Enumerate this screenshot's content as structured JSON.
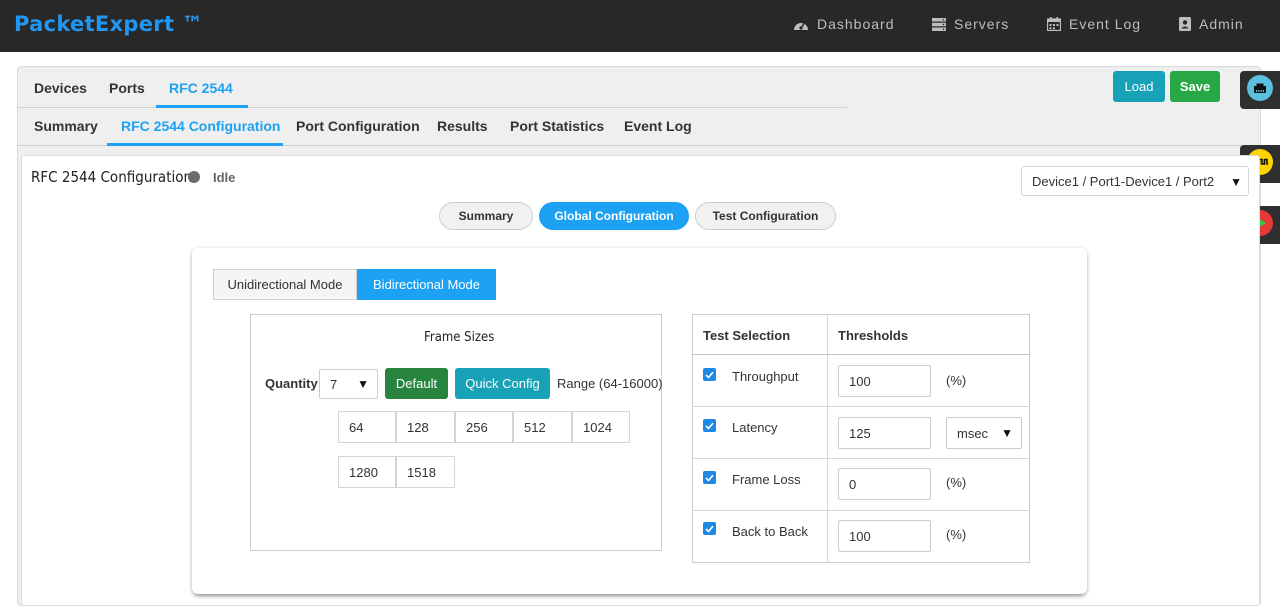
{
  "app": {
    "brand": "PacketExpert ™"
  },
  "topnav": [
    {
      "label": "Dashboard",
      "icon": "dashboard-icon"
    },
    {
      "label": "Servers",
      "icon": "servers-icon"
    },
    {
      "label": "Event Log",
      "icon": "calendar-icon"
    },
    {
      "label": "Admin",
      "icon": "user-card-icon"
    }
  ],
  "main_tabs": {
    "items": [
      "Devices",
      "Ports",
      "RFC 2544"
    ],
    "active": "RFC 2544"
  },
  "sub_tabs": {
    "items": [
      "Summary",
      "RFC 2544 Configuration",
      "Port Configuration",
      "Results",
      "Port Statistics",
      "Event Log"
    ],
    "active": "RFC 2544 Configuration"
  },
  "toolbar": {
    "load_label": "Load",
    "save_label": "Save"
  },
  "dock": [
    {
      "icon": "ethernet-port-icon",
      "color": "#5bc0de"
    },
    {
      "icon": "waveform-icon",
      "color": "#ffd400"
    },
    {
      "icon": "play-icon",
      "color": "#e53935"
    }
  ],
  "page": {
    "title": "RFC 2544 Configuration",
    "status": "Idle",
    "status_color": "#6c6c6c",
    "device_selection": "Device1 / Port1-Device1 / Port2"
  },
  "section_tabs": {
    "items": [
      "Summary",
      "Global Configuration",
      "Test Configuration"
    ],
    "active": "Global Configuration"
  },
  "mode": {
    "options": [
      "Unidirectional Mode",
      "Bidirectional Mode"
    ],
    "active": "Bidirectional Mode"
  },
  "frame_sizes": {
    "title": "Frame Sizes",
    "quantity_label": "Quantity",
    "quantity": "7",
    "default_label": "Default",
    "quick_config_label": "Quick Config",
    "range_label": "Range (64-16000)",
    "values": [
      "64",
      "128",
      "256",
      "512",
      "1024",
      "1280",
      "1518"
    ]
  },
  "test_selection": {
    "header_test": "Test Selection",
    "header_thresholds": "Thresholds",
    "rows": [
      {
        "label": "Throughput",
        "checked": true,
        "value": "100",
        "unit": "(%)"
      },
      {
        "label": "Latency",
        "checked": true,
        "value": "125",
        "unit": "msec"
      },
      {
        "label": "Frame Loss",
        "checked": true,
        "value": "0",
        "unit": "(%)"
      },
      {
        "label": "Back to Back",
        "checked": true,
        "value": "100",
        "unit": "(%)"
      }
    ]
  },
  "colors": {
    "accent": "#1da1f2",
    "success": "#28a745",
    "info": "#17a2b8",
    "header_bg": "#282828"
  }
}
